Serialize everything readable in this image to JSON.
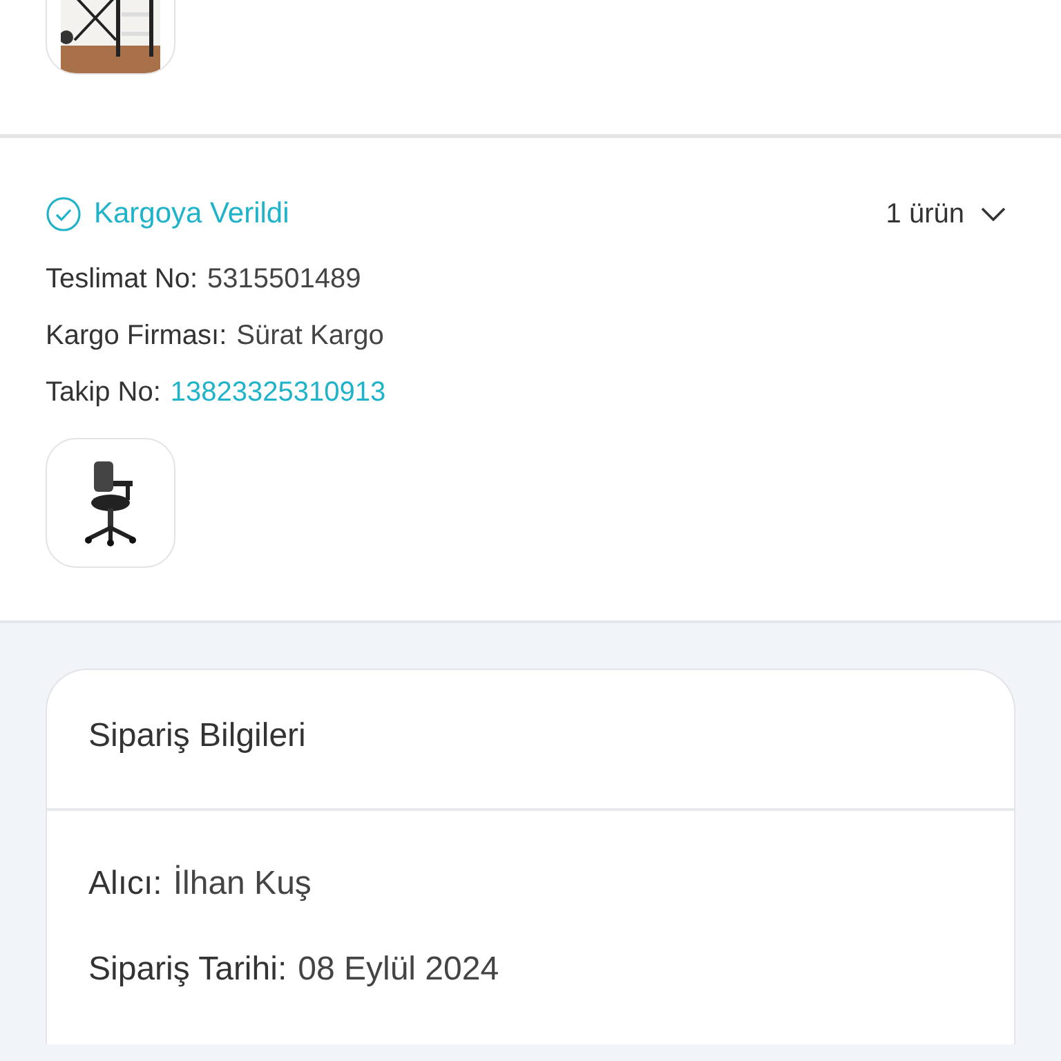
{
  "shipment": {
    "status": "Kargoya Verildi",
    "item_count": "1 ürün",
    "fields": [
      {
        "label": "Teslimat No:",
        "value": "5315501489",
        "kind": "text"
      },
      {
        "label": "Kargo Firması:",
        "value": "Sürat Kargo",
        "kind": "text"
      },
      {
        "label": "Takip No:",
        "value": "13823325310913",
        "kind": "link"
      }
    ]
  },
  "order_info": {
    "title": "Sipariş Bilgileri",
    "fields": [
      {
        "label": "Alıcı:",
        "value": "İlhan Kuş"
      },
      {
        "label": "Sipariş Tarihi:",
        "value": "08 Eylül 2024"
      }
    ]
  }
}
